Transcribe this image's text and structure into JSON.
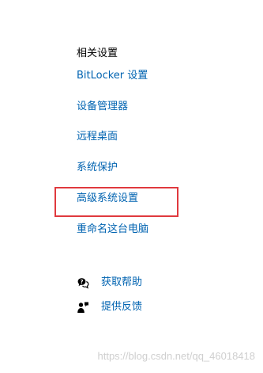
{
  "related_settings": {
    "heading": "相关设置",
    "links": [
      "BitLocker 设置",
      "设备管理器",
      "远程桌面",
      "系统保护",
      "高级系统设置",
      "重命名这台电脑"
    ]
  },
  "help": {
    "get_help_label": "获取帮助",
    "get_help_icon": "help-chat-icon",
    "feedback_label": "提供反馈",
    "feedback_icon": "feedback-person-icon"
  },
  "highlight": {
    "target": "高级系统设置",
    "color": "#e0393e"
  },
  "colors": {
    "link": "#0063b1",
    "heading": "#000000",
    "background": "#ffffff"
  },
  "watermark": "https://blog.csdn.net/qq_46018418"
}
